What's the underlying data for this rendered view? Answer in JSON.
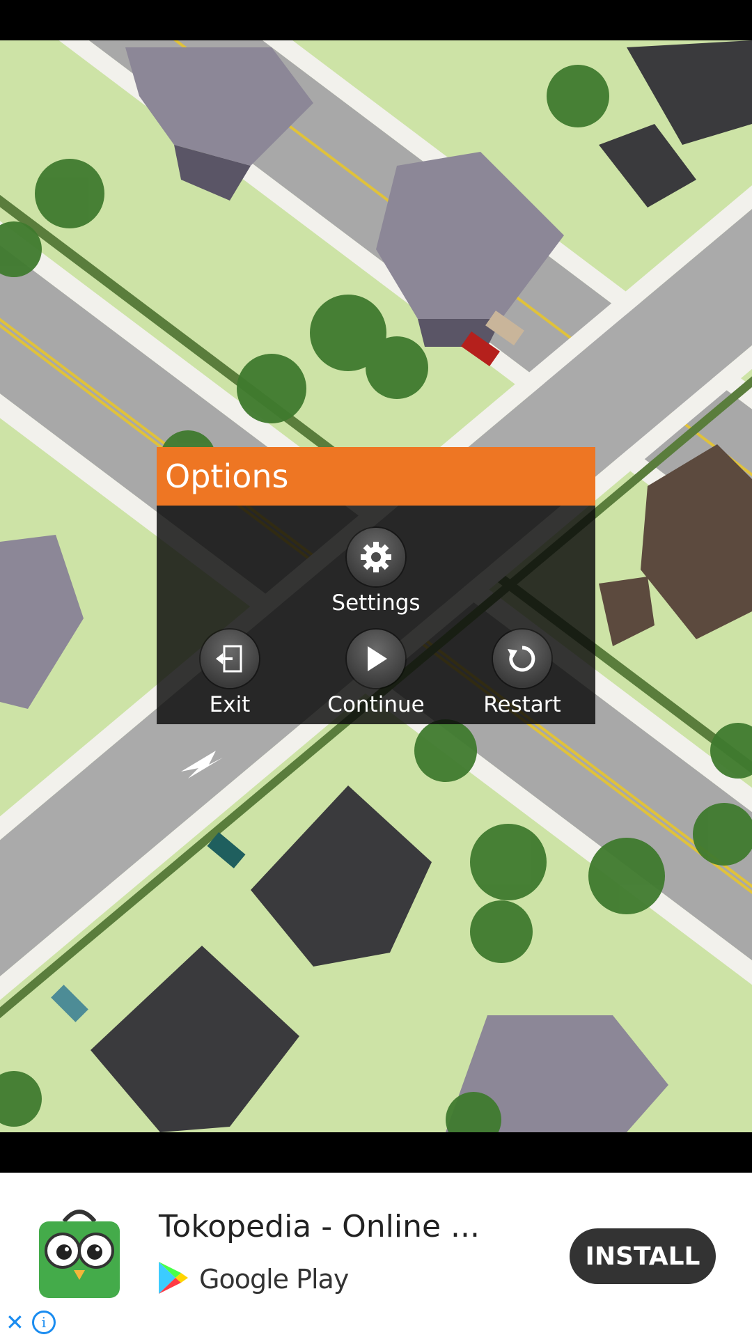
{
  "dialog": {
    "title": "Options",
    "settings_label": "Settings",
    "exit_label": "Exit",
    "continue_label": "Continue",
    "restart_label": "Restart"
  },
  "ad": {
    "title": "Tokopedia - Online ...",
    "store": "Google Play",
    "install_label": "INSTALL",
    "close_glyph": "✕",
    "info_glyph": "i"
  },
  "colors": {
    "dialog_header": "#ee7623",
    "dialog_body": "#1a1a1a",
    "grass": "#cde3a6",
    "road": "#a7a7a7",
    "install_button": "#333333"
  },
  "icons": [
    "gear-icon",
    "exit-icon",
    "play-icon",
    "restart-icon",
    "google-play-icon",
    "tokopedia-logo",
    "close-icon",
    "info-icon"
  ]
}
